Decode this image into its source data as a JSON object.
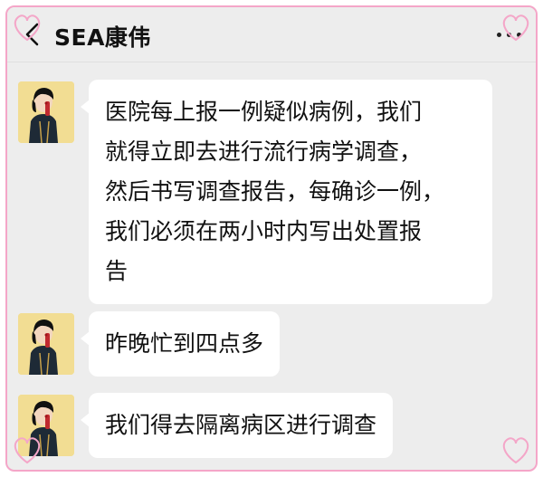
{
  "header": {
    "title": "SEA康伟",
    "back_icon": "chevron-left-icon",
    "more_icon": "more-dots-icon"
  },
  "messages": [
    {
      "line1": "医院每上报一例疑似病例，我们",
      "line2": "就得立即去进行流行病学调查，",
      "line3": "然后书写调查报告，每确诊一例，",
      "line4": "我们必须在两小时内写出处置报",
      "line5": "告"
    },
    {
      "text": "昨晚忙到四点多"
    },
    {
      "text": "我们得去隔离病区进行调查"
    }
  ],
  "colors": {
    "frame_border": "#f4a6c8",
    "background": "#ededed",
    "bubble": "#ffffff",
    "avatar_bg": "#f2dd93"
  }
}
